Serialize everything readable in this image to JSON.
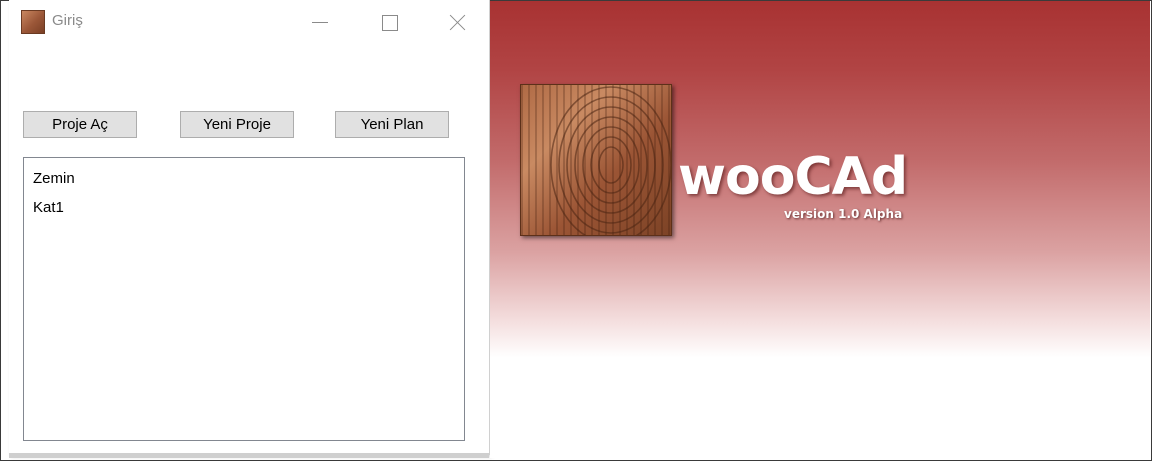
{
  "window": {
    "title": "Giriş",
    "icon": "app-icon"
  },
  "toolbar": {
    "open_project_label": "Proje Aç",
    "new_project_label": "Yeni Proje",
    "new_plan_label": "Yeni Plan"
  },
  "plans": {
    "items": [
      {
        "label": "Zemin"
      },
      {
        "label": "Kat1"
      }
    ]
  },
  "splash": {
    "brand": "wooCAd",
    "version": "version 1.0 Alpha",
    "colors": {
      "gradient_top": "#a83232",
      "gradient_bottom": "#ffffff",
      "logo_wood": "#b06a45"
    }
  }
}
